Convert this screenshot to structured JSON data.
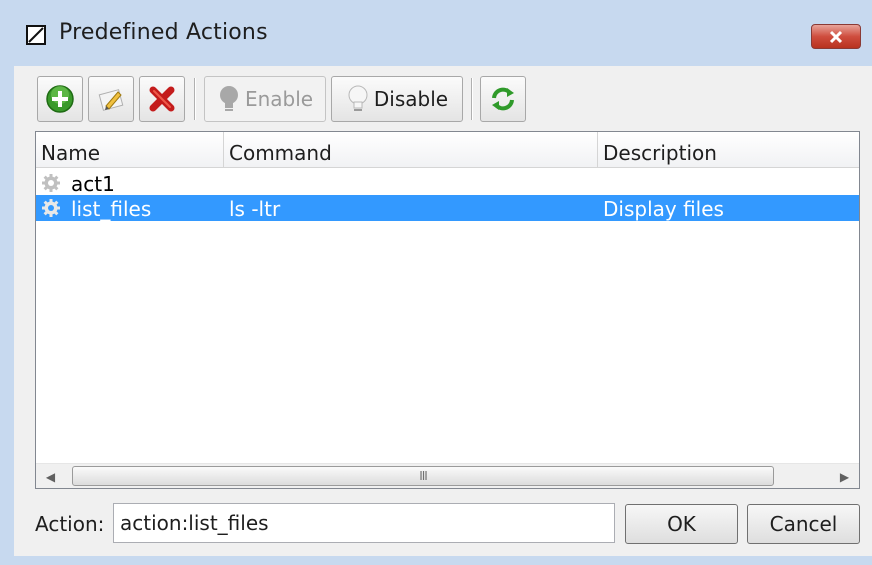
{
  "window": {
    "title": "Predefined Actions"
  },
  "toolbar": {
    "add_icon": "plus-circle-icon",
    "edit_icon": "pencil-icon",
    "delete_icon": "red-x-icon",
    "enable_label": "Enable",
    "disable_label": "Disable",
    "refresh_icon": "refresh-icon"
  },
  "list": {
    "columns": [
      "Name",
      "Command",
      "Description"
    ],
    "rows": [
      {
        "name": "act1",
        "command": "",
        "description": "",
        "icon": "gear-icon",
        "selected": false
      },
      {
        "name": "list_files",
        "command": "ls -ltr",
        "description": "Display files",
        "icon": "gear-icon",
        "selected": true
      }
    ],
    "scrollbar": {
      "grip": "III"
    }
  },
  "action": {
    "label": "Action:",
    "value": "action:list_files"
  },
  "buttons": {
    "ok": "OK",
    "cancel": "Cancel"
  },
  "colors": {
    "titlebar": "#c7d9ef",
    "selection": "#3399ff",
    "close": "#cf4d3e"
  }
}
